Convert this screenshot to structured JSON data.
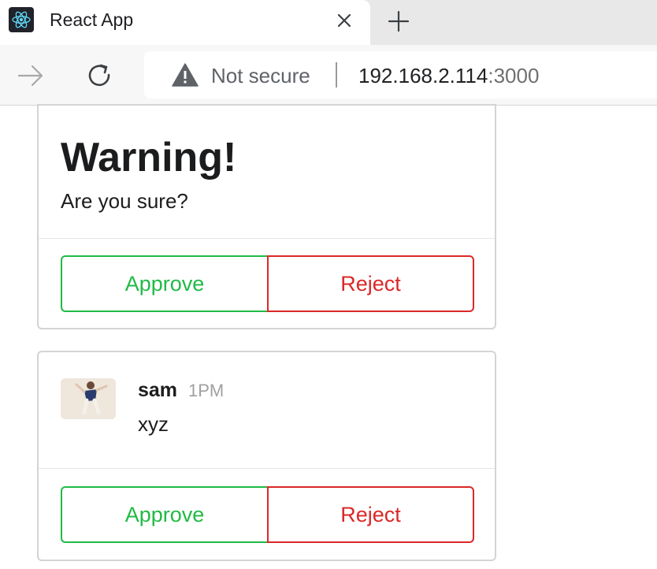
{
  "browser": {
    "tab": {
      "title": "React App",
      "favicon": "react-logo-icon",
      "close_icon": "close-icon"
    },
    "new_tab_icon": "plus-icon",
    "nav": {
      "forward_icon": "arrow-right-icon",
      "reload_icon": "reload-icon"
    },
    "omnibox": {
      "security_icon": "warning-triangle-icon",
      "security_text": "Not secure",
      "url_host": "192.168.2.114",
      "url_port": ":3000"
    }
  },
  "cards": [
    {
      "header": "Warning!",
      "description": "Are you sure?",
      "approve_label": "Approve",
      "reject_label": "Reject"
    },
    {
      "comment": {
        "author": "sam",
        "date": "1PM",
        "text": "xyz"
      },
      "approve_label": "Approve",
      "reject_label": "Reject"
    }
  ],
  "colors": {
    "approve": "#21ba45",
    "reject": "#db2828",
    "react_accent": "#61dafb"
  }
}
